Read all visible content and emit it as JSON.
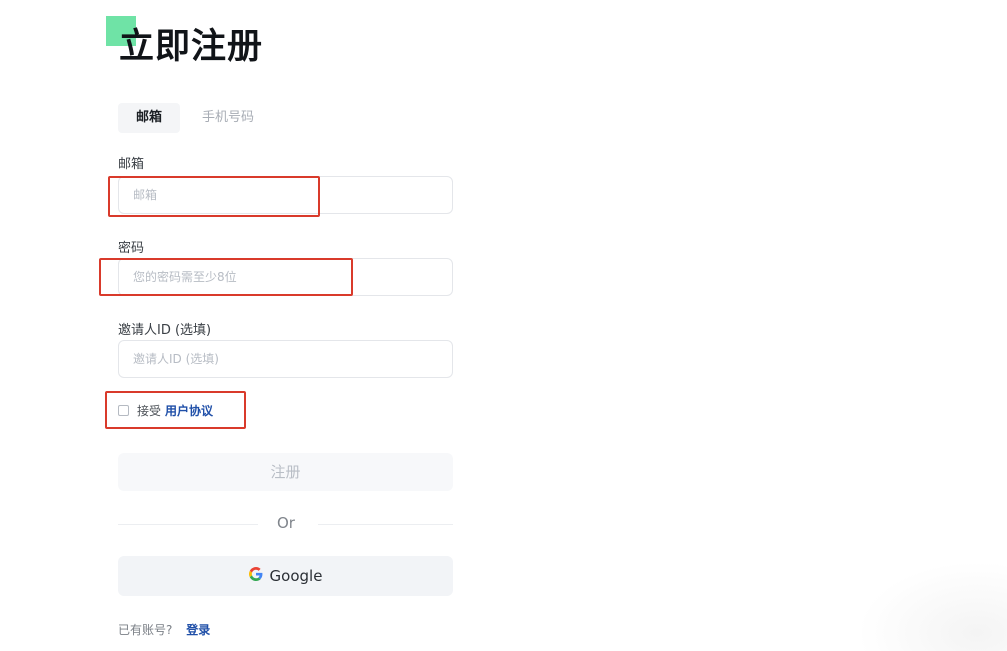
{
  "page": {
    "title": "立即注册",
    "accent_color": "#6fe3a6"
  },
  "tabs": [
    {
      "label": "邮箱",
      "selected": true
    },
    {
      "label": "手机号码",
      "selected": false
    }
  ],
  "form": {
    "email": {
      "label": "邮箱",
      "placeholder": "邮箱",
      "value": ""
    },
    "password": {
      "label": "密码",
      "placeholder": "您的密码需至少8位",
      "value": ""
    },
    "inviter": {
      "label": "邀请人ID (选填)",
      "placeholder": "邀请人ID (选填)",
      "value": ""
    },
    "agreement": {
      "prefix": "接受",
      "link": "用户协议",
      "checked": false
    }
  },
  "actions": {
    "register_label": "注册",
    "divider_text": "Or",
    "google_label": "Google"
  },
  "footer": {
    "prompt": "已有账号?",
    "login_link": "登录"
  },
  "annotations": {
    "highlight_color": "#d93a2b"
  },
  "icons": {
    "google": "google-icon"
  }
}
